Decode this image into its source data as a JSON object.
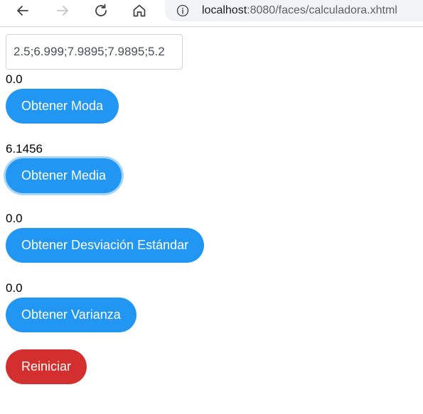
{
  "browser": {
    "url_host": "localhost",
    "url_rest": ":8080/faces/calculadora.xhtml"
  },
  "form": {
    "numbers_value": "2.5;6.999;7.9895;7.9895;5.2"
  },
  "results": {
    "moda": "0.0",
    "media": "6.1456",
    "desviacion": "0.0",
    "varianza": "0.0"
  },
  "buttons": {
    "moda": "Obtener Moda",
    "media": "Obtener Media",
    "desviacion": "Obtener Desviación Estándar",
    "varianza": "Obtener Varianza",
    "reset": "Reiniciar"
  },
  "colors": {
    "primary": "#2196f3",
    "danger": "#d32f2f",
    "focus_ring": "#a6d5fa"
  }
}
